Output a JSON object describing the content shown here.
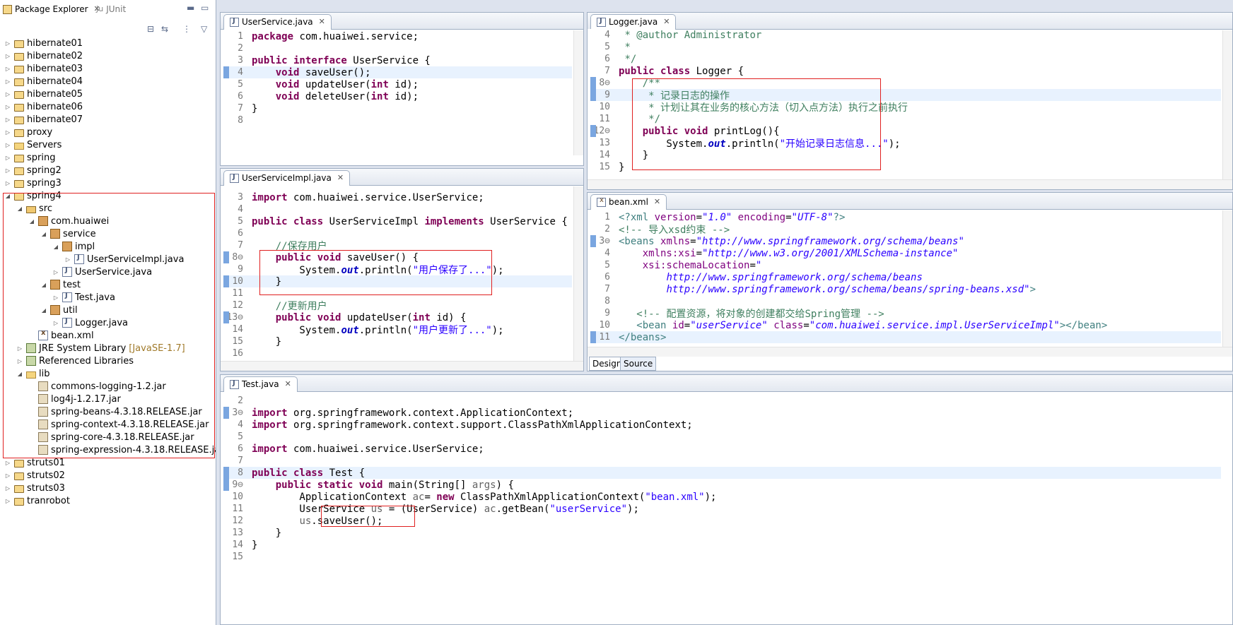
{
  "explorer": {
    "tabs": [
      "Package Explorer",
      "JUnit"
    ],
    "tree": [
      {
        "label": "hibernate01",
        "depth": 0,
        "icon": "project-icon",
        "tw": "collapsed"
      },
      {
        "label": "hibernate02",
        "depth": 0,
        "icon": "project-icon",
        "tw": "collapsed"
      },
      {
        "label": "hibernate03",
        "depth": 0,
        "icon": "project-icon",
        "tw": "collapsed"
      },
      {
        "label": "hibernate04",
        "depth": 0,
        "icon": "project-icon",
        "tw": "collapsed"
      },
      {
        "label": "hibernate05",
        "depth": 0,
        "icon": "project-icon",
        "tw": "collapsed"
      },
      {
        "label": "hibernate06",
        "depth": 0,
        "icon": "project-icon",
        "tw": "collapsed"
      },
      {
        "label": "hibernate07",
        "depth": 0,
        "icon": "project-icon",
        "tw": "collapsed"
      },
      {
        "label": "proxy",
        "depth": 0,
        "icon": "project-icon",
        "tw": "collapsed"
      },
      {
        "label": "Servers",
        "depth": 0,
        "icon": "folder-icon",
        "tw": "collapsed"
      },
      {
        "label": "spring",
        "depth": 0,
        "icon": "project-icon",
        "tw": "collapsed"
      },
      {
        "label": "spring2",
        "depth": 0,
        "icon": "project-icon",
        "tw": "collapsed"
      },
      {
        "label": "spring3",
        "depth": 0,
        "icon": "project-icon",
        "tw": "collapsed"
      },
      {
        "label": "spring4",
        "depth": 0,
        "icon": "project-icon",
        "tw": "expanded"
      },
      {
        "label": "src",
        "depth": 1,
        "icon": "source-folder-icon",
        "tw": "expanded"
      },
      {
        "label": "com.huaiwei",
        "depth": 2,
        "icon": "package-icon",
        "tw": "expanded"
      },
      {
        "label": "service",
        "depth": 3,
        "icon": "package-icon",
        "tw": "expanded"
      },
      {
        "label": "impl",
        "depth": 4,
        "icon": "package-icon",
        "tw": "expanded"
      },
      {
        "label": "UserServiceImpl.java",
        "depth": 5,
        "icon": "java-file-icon",
        "tw": "collapsed"
      },
      {
        "label": "UserService.java",
        "depth": 4,
        "icon": "java-file-icon",
        "tw": "collapsed"
      },
      {
        "label": "test",
        "depth": 3,
        "icon": "package-icon",
        "tw": "expanded"
      },
      {
        "label": "Test.java",
        "depth": 4,
        "icon": "java-file-icon",
        "tw": "collapsed"
      },
      {
        "label": "util",
        "depth": 3,
        "icon": "package-icon",
        "tw": "expanded"
      },
      {
        "label": "Logger.java",
        "depth": 4,
        "icon": "java-file-icon",
        "tw": "collapsed"
      },
      {
        "label": "bean.xml",
        "depth": 2,
        "icon": "xml-file-icon",
        "tw": "none"
      },
      {
        "label": "JRE System Library",
        "suffix": "[JavaSE-1.7]",
        "depth": 1,
        "icon": "library-icon",
        "tw": "collapsed"
      },
      {
        "label": "Referenced Libraries",
        "depth": 1,
        "icon": "library-icon",
        "tw": "collapsed"
      },
      {
        "label": "lib",
        "depth": 1,
        "icon": "folder-icon",
        "tw": "expanded"
      },
      {
        "label": "commons-logging-1.2.jar",
        "depth": 2,
        "icon": "jar-icon",
        "tw": "none"
      },
      {
        "label": "log4j-1.2.17.jar",
        "depth": 2,
        "icon": "jar-icon",
        "tw": "none"
      },
      {
        "label": "spring-beans-4.3.18.RELEASE.jar",
        "depth": 2,
        "icon": "jar-icon",
        "tw": "none"
      },
      {
        "label": "spring-context-4.3.18.RELEASE.jar",
        "depth": 2,
        "icon": "jar-icon",
        "tw": "none"
      },
      {
        "label": "spring-core-4.3.18.RELEASE.jar",
        "depth": 2,
        "icon": "jar-icon",
        "tw": "none"
      },
      {
        "label": "spring-expression-4.3.18.RELEASE.jar",
        "depth": 2,
        "icon": "jar-icon",
        "tw": "none"
      },
      {
        "label": "struts01",
        "depth": 0,
        "icon": "project-icon",
        "tw": "collapsed"
      },
      {
        "label": "struts02",
        "depth": 0,
        "icon": "project-icon",
        "tw": "collapsed"
      },
      {
        "label": "struts03",
        "depth": 0,
        "icon": "project-icon",
        "tw": "collapsed"
      },
      {
        "label": "tranrobot",
        "depth": 0,
        "icon": "project-icon",
        "tw": "collapsed"
      }
    ]
  },
  "editors": {
    "userservice": {
      "tab": "UserService.java",
      "lines": [
        {
          "n": "1",
          "html": "<span class=kw>package</span> com.huaiwei.service;"
        },
        {
          "n": "2",
          "html": ""
        },
        {
          "n": "3",
          "html": "<span class=kw>public interface</span> UserService {"
        },
        {
          "n": "4",
          "html": "    <span class=kw>void</span> saveUser();",
          "hl": true
        },
        {
          "n": "5",
          "html": "    <span class=kw>void</span> updateUser(<span class=kw>int</span> id);"
        },
        {
          "n": "6",
          "html": "    <span class=kw>void</span> deleteUser(<span class=kw>int</span> id);"
        },
        {
          "n": "7",
          "html": "}"
        },
        {
          "n": "8",
          "html": ""
        }
      ]
    },
    "logger": {
      "tab": "Logger.java",
      "lines": [
        {
          "n": "4",
          "html": " <span class=cm>* @author Administrator</span>"
        },
        {
          "n": "5",
          "html": " <span class=cm>*</span>"
        },
        {
          "n": "6",
          "html": " <span class=cm>*/</span>"
        },
        {
          "n": "7",
          "html": "<span class=kw>public class</span> Logger {"
        },
        {
          "n": "8⊖",
          "html": "    <span class=cm>/**</span>"
        },
        {
          "n": "9",
          "html": "     <span class=cm>* 记录日志的操作</span>",
          "hl": true
        },
        {
          "n": "10",
          "html": "     <span class=cm>* 计划让其在业务的核心方法（切入点方法）执行之前执行</span>"
        },
        {
          "n": "11",
          "html": "     <span class=cm>*/</span>"
        },
        {
          "n": "12⊖",
          "html": "    <span class=kw>public void</span> printLog(){"
        },
        {
          "n": "13",
          "html": "        System.<span class=fld>out</span>.println(<span class=st>\"开始记录日志信息...\"</span>);"
        },
        {
          "n": "14",
          "html": "    }"
        },
        {
          "n": "15",
          "html": "}"
        }
      ]
    },
    "impl": {
      "tab": "UserServiceImpl.java",
      "lines": [
        {
          "n": "3",
          "html": "<span class=kw>import</span> com.huaiwei.service.UserService;"
        },
        {
          "n": "4",
          "html": ""
        },
        {
          "n": "5",
          "html": "<span class=kw>public class</span> UserServiceImpl <span class=kw>implements</span> UserService {"
        },
        {
          "n": "6",
          "html": ""
        },
        {
          "n": "7",
          "html": "    <span class=cm>//保存用户</span>"
        },
        {
          "n": "8⊖",
          "html": "    <span class=kw>public void</span> saveUser() {"
        },
        {
          "n": "9",
          "html": "        System.<span class=fld>out</span>.println(<span class=st>\"用户保存了...\"</span>);"
        },
        {
          "n": "10",
          "html": "    }",
          "hl": true
        },
        {
          "n": "11",
          "html": ""
        },
        {
          "n": "12",
          "html": "    <span class=cm>//更新用户</span>"
        },
        {
          "n": "13⊖",
          "html": "    <span class=kw>public void</span> updateUser(<span class=kw>int</span> id) {"
        },
        {
          "n": "14",
          "html": "        System.<span class=fld>out</span>.println(<span class=st>\"用户更新了...\"</span>);"
        },
        {
          "n": "15",
          "html": "    }"
        },
        {
          "n": "16",
          "html": ""
        }
      ]
    },
    "beanxml": {
      "tab": "bean.xml",
      "bottom_tabs": [
        "Design",
        "Source"
      ],
      "lines": [
        {
          "n": "1",
          "html": "<span class=tag>&lt;?xml</span> <span class=attr>version</span>=<span class=val>\"1.0\"</span> <span class=attr>encoding</span>=<span class=val>\"UTF-8\"</span><span class=tag>?&gt;</span>"
        },
        {
          "n": "2",
          "html": "<span class=cm>&lt;!-- 导入xsd约束 --&gt;</span>"
        },
        {
          "n": "3⊖",
          "html": "<span class=tag>&lt;beans</span> <span class=attr>xmlns</span>=<span class=val>\"http://www.springframework.org/schema/beans\"</span>"
        },
        {
          "n": "4",
          "html": "    <span class=attr>xmlns:xsi</span>=<span class=val>\"http://www.w3.org/2001/XMLSchema-instance\"</span>"
        },
        {
          "n": "5",
          "html": "    <span class=attr>xsi:schemaLocation</span>=<span class=val>\"</span>"
        },
        {
          "n": "6",
          "html": "        <span class=val>http://www.springframework.org/schema/beans</span>"
        },
        {
          "n": "7",
          "html": "        <span class=val>http://www.springframework.org/schema/beans/spring-beans.xsd\"</span><span class=tag>&gt;</span>"
        },
        {
          "n": "8",
          "html": ""
        },
        {
          "n": "9",
          "html": "   <span class=cm>&lt;!-- 配置资源，将对象的创建都交给Spring管理 --&gt;</span>"
        },
        {
          "n": "10",
          "html": "   <span class=tag>&lt;bean</span> <span class=attr>id</span>=<span class=val>\"userService\"</span> <span class=attr>class</span>=<span class=val>\"com.huaiwei.service.impl.UserServiceImpl\"</span><span class=tag>&gt;&lt;/bean&gt;</span>"
        },
        {
          "n": "11",
          "html": "<span class=tag>&lt;/beans&gt;</span>",
          "hl": true
        }
      ]
    },
    "test": {
      "tab": "Test.java",
      "lines": [
        {
          "n": "2",
          "html": ""
        },
        {
          "n": "3⊖",
          "html": "<span class=kw>import</span> org.springframework.context.ApplicationContext;"
        },
        {
          "n": "4",
          "html": "<span class=kw>import</span> org.springframework.context.support.ClassPathXmlApplicationContext;"
        },
        {
          "n": "5",
          "html": ""
        },
        {
          "n": "6",
          "html": "<span class=kw>import</span> com.huaiwei.service.UserService;"
        },
        {
          "n": "7",
          "html": ""
        },
        {
          "n": "8",
          "html": "<span class=kw>public class</span> Test {",
          "hl": true
        },
        {
          "n": "9⊖",
          "html": "    <span class=kw>public static void</span> main(String[] <span class=ann>args</span>) {"
        },
        {
          "n": "10",
          "html": "        ApplicationContext <span class=ann>ac</span>= <span class=kw>new</span> ClassPathXmlApplicationContext(<span class=st>\"bean.xml\"</span>);"
        },
        {
          "n": "11",
          "html": "        UserService <span class=ann>us</span> = (UserService) <span class=ann>ac</span>.getBean(<span class=st>\"userService\"</span>);"
        },
        {
          "n": "12",
          "html": "        <span class=ann>us</span>.saveUser();"
        },
        {
          "n": "13",
          "html": "    }"
        },
        {
          "n": "14",
          "html": "}"
        },
        {
          "n": "15",
          "html": ""
        }
      ]
    }
  }
}
